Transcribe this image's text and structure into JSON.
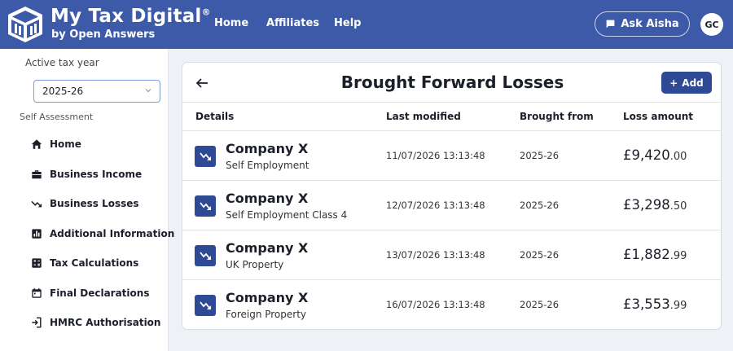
{
  "brand": {
    "title": "My Tax Digital",
    "reg": "®",
    "subtitle": "by Open Answers"
  },
  "nav": {
    "home": "Home",
    "affiliates": "Affiliates",
    "help": "Help"
  },
  "ask": {
    "label": "Ask Aisha",
    "icon": "chat-bubble-icon"
  },
  "user": {
    "initials": "GC"
  },
  "sidebar": {
    "tax_year_label": "Active tax year",
    "tax_year_value": "2025-26",
    "section_label": "Self Assessment",
    "items": [
      {
        "label": "Home",
        "icon": "house-icon"
      },
      {
        "label": "Business Income",
        "icon": "briefcase-icon"
      },
      {
        "label": "Business Losses",
        "icon": "trending-down-icon"
      },
      {
        "label": "Additional Information",
        "icon": "bar-chart-icon"
      },
      {
        "label": "Tax Calculations",
        "icon": "calculator-icon"
      },
      {
        "label": "Final Declarations",
        "icon": "calendar-icon"
      },
      {
        "label": "HMRC Authorisation",
        "icon": "login-icon"
      }
    ]
  },
  "page": {
    "title": "Brought Forward Losses",
    "add_label": "Add"
  },
  "table": {
    "headers": {
      "details": "Details",
      "last_modified": "Last modified",
      "brought_from": "Brought from",
      "loss_amount": "Loss amount"
    },
    "rows": [
      {
        "company": "Company X",
        "type": "Self Employment",
        "modified": "11/07/2026 13:13:48",
        "from": "2025-26",
        "amount_main": "£9,420",
        "amount_pence": ".00"
      },
      {
        "company": "Company X",
        "type": "Self Employment Class 4",
        "modified": "12/07/2026 13:13:48",
        "from": "2025-26",
        "amount_main": "£3,298",
        "amount_pence": ".50"
      },
      {
        "company": "Company X",
        "type": "UK Property",
        "modified": "13/07/2026 13:13:48",
        "from": "2025-26",
        "amount_main": "£1,882",
        "amount_pence": ".99"
      },
      {
        "company": "Company X",
        "type": "Foreign Property",
        "modified": "16/07/2026 13:13:48",
        "from": "2025-26",
        "amount_main": "£3,553",
        "amount_pence": ".99"
      }
    ]
  },
  "colors": {
    "header": "#3d5aa8",
    "accent": "#2f4a94",
    "background": "#eef2f7"
  }
}
